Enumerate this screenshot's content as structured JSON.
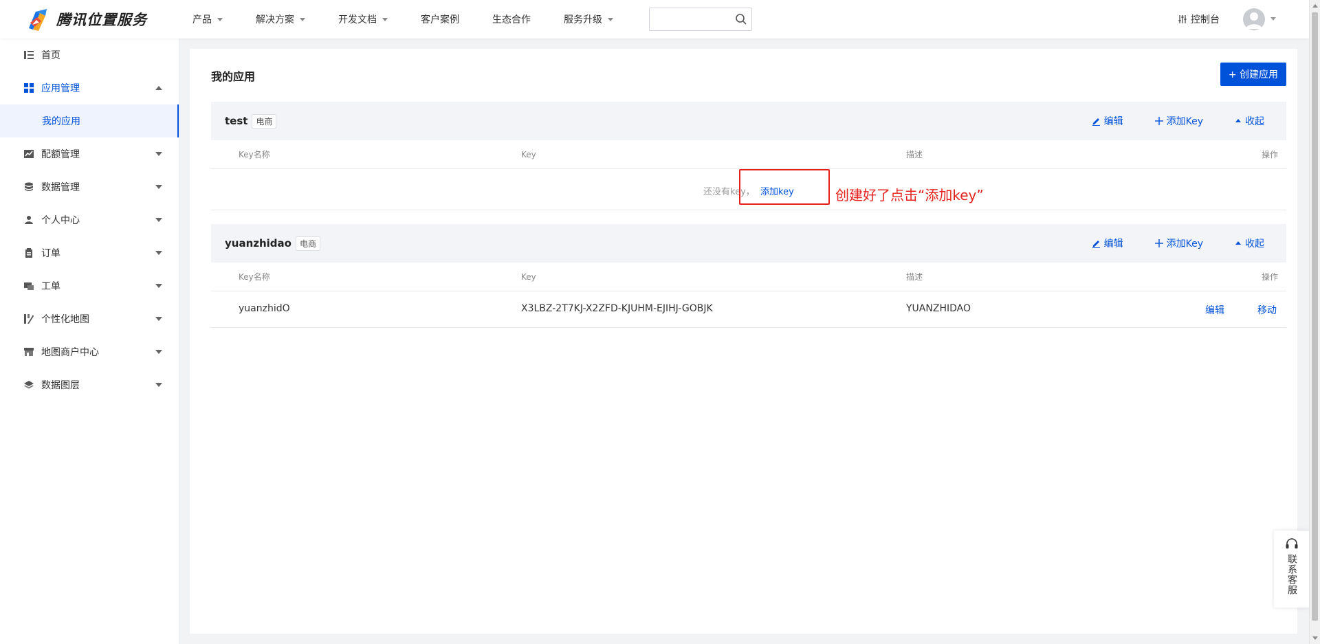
{
  "header": {
    "brand": "腾讯位置服务",
    "nav": [
      {
        "label": "产品",
        "has_caret": true
      },
      {
        "label": "解决方案",
        "has_caret": true
      },
      {
        "label": "开发文档",
        "has_caret": true
      },
      {
        "label": "客户案例",
        "has_caret": false
      },
      {
        "label": "生态合作",
        "has_caret": false
      },
      {
        "label": "服务升级",
        "has_caret": true
      }
    ],
    "search": {
      "placeholder": ""
    },
    "console_label": "控制台"
  },
  "sidebar": {
    "items": [
      {
        "label": "首页",
        "icon": "list-icon"
      },
      {
        "label": "应用管理",
        "icon": "grid-icon",
        "expanded": true
      },
      {
        "label": "我的应用",
        "sub": true,
        "selected": true
      },
      {
        "label": "配额管理",
        "icon": "chart-icon"
      },
      {
        "label": "数据管理",
        "icon": "database-icon"
      },
      {
        "label": "个人中心",
        "icon": "user-icon"
      },
      {
        "label": "订单",
        "icon": "clipboard-icon"
      },
      {
        "label": "工单",
        "icon": "ticket-icon"
      },
      {
        "label": "个性化地图",
        "icon": "map-style-icon"
      },
      {
        "label": "地图商户中心",
        "icon": "store-icon"
      },
      {
        "label": "数据图层",
        "icon": "layers-icon"
      }
    ]
  },
  "main": {
    "title": "我的应用",
    "create_button": "+ 创建应用",
    "columns": [
      "Key名称",
      "Key",
      "描述",
      "操作"
    ],
    "actions": {
      "edit": "编辑",
      "add_key": "添加Key",
      "collapse": "收起"
    },
    "apps": [
      {
        "name": "test",
        "tag": "电商",
        "empty_text": "还没有key，",
        "empty_link": "添加key",
        "keys": []
      },
      {
        "name": "yuanzhidao",
        "tag": "电商",
        "keys": [
          {
            "name": "yuanzhidO",
            "key": "X3LBZ-2T7KJ-X2ZFD-KJUHM-EJIHJ-GOBJK",
            "desc": "YUANZHIDAO",
            "edit": "编辑",
            "move": "移动"
          }
        ]
      }
    ]
  },
  "annotation": {
    "note": "创建好了点击“添加key”",
    "color": "#e5211b"
  },
  "support": {
    "label": "联系客服"
  },
  "colors": {
    "accent": "#0052d9",
    "sidebar_active_bg": "#eef3fe"
  }
}
